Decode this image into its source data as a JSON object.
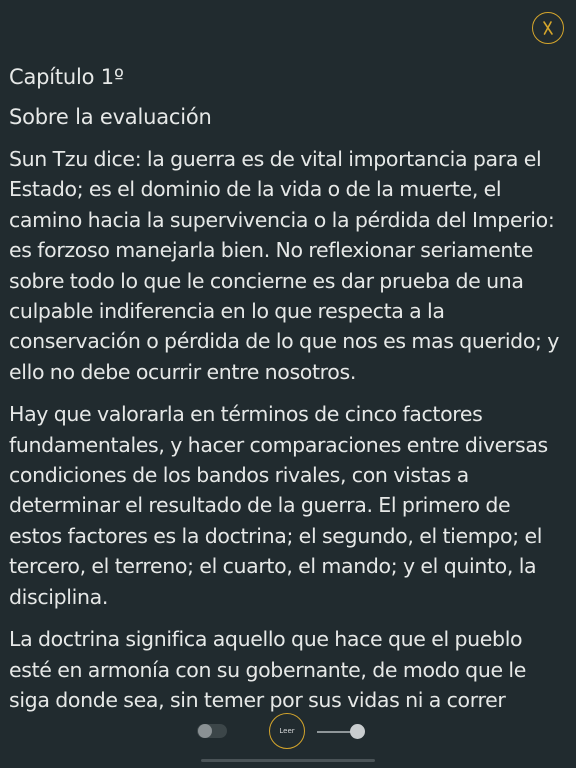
{
  "reader": {
    "chapter_title": "Capítulo 1º",
    "section_title": "Sobre la evaluación",
    "paragraphs": [
      "Sun Tzu dice: la guerra es de vital importancia para el Estado; es el dominio de la vida o de la muerte, el camino hacia la supervivencia o la pérdida del Imperio: es forzoso manejarla bien. No reflexionar seriamente sobre todo lo que le concierne es dar prueba de una culpable indiferencia en lo que respecta a la conservación o pérdida de lo que nos es mas querido; y ello no debe ocurrir entre nosotros.",
      "Hay que valorarla en términos de cinco factores fundamentales, y hacer comparaciones entre diversas condiciones de los bandos rivales, con vistas a determinar el resultado de la guerra. El primero de estos factores es la doctrina; el segundo, el tiempo; el tercero, el terreno; el cuarto, el mando; y el quinto, la disciplina.",
      "La doctrina significa aquello que hace que el pueblo esté en armonía con su gobernante, de modo que le siga donde sea, sin temer por sus vidas ni a correr cualquier peligro."
    ]
  },
  "controls": {
    "read_label": "Leer",
    "toggle_on": false,
    "slider_value": 1.0
  },
  "icons": {
    "close": "close-icon"
  },
  "colors": {
    "background": "#212b2f",
    "text": "#e6e8e7",
    "accent": "#d4a52c"
  }
}
